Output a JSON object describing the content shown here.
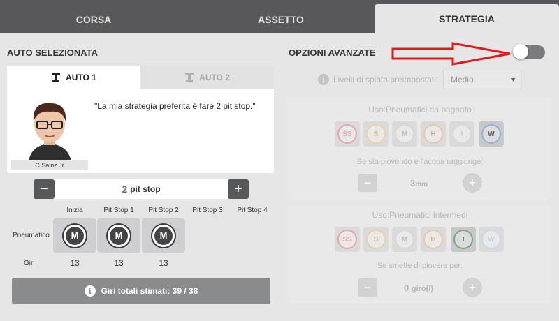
{
  "tabs": [
    {
      "label": "CORSA"
    },
    {
      "label": "ASSETTO"
    },
    {
      "label": "STRATEGIA"
    }
  ],
  "left": {
    "section_title": "AUTO SELEZIONATA",
    "car_tabs": [
      {
        "label": "AUTO 1"
      },
      {
        "label": "AUTO 2"
      }
    ],
    "driver_name": "C Sainz Jr",
    "quote": "\"La mia strategia preferita è fare 2 pit stop.\"",
    "pit_stepper": {
      "minus": "−",
      "value": "2",
      "unit": "pit stop",
      "plus": "+"
    },
    "columns": [
      "Inizia",
      "Pit Stop 1",
      "Pit Stop 2",
      "Pit Stop 3",
      "Pit Stop 4"
    ],
    "row_tyre_label": "Pneumatico",
    "row_laps_label": "Giri",
    "tyres": [
      "M",
      "M",
      "M"
    ],
    "laps": [
      "13",
      "13",
      "13"
    ],
    "total_laps": "Giri totali stimati: 39 / 38",
    "info_glyph": "i"
  },
  "right": {
    "section_title": "OPZIONI AVANZATE",
    "preset_label": "Livelli di spinta preimpostati:",
    "preset_value": "Medio",
    "preset_chevron": "▼",
    "wet_box": {
      "title": "Uso:Pneumatici da bagnato",
      "tyres": [
        "SS",
        "S",
        "M",
        "H",
        "I",
        "W"
      ],
      "subtitle": "Se sta piovendo e l'acqua raggiunge:",
      "value": "3",
      "unit": "mm"
    },
    "inter_box": {
      "title": "Uso:Pneumatici intermedi",
      "tyres": [
        "SS",
        "S",
        "M",
        "H",
        "I",
        "W"
      ],
      "subtitle": "Se smette di piovere per:",
      "value": "0",
      "unit": "giro(i)"
    },
    "minus": "−",
    "plus": "+"
  },
  "colors": {
    "tab_bar": "#58585a",
    "accent_green": "#4a8b3c",
    "arrow_red": "#e0191b",
    "tyre_ss": "#e9a6a6",
    "tyre_s": "#ecd2a1",
    "tyre_m": "#d8d8d8",
    "tyre_h": "#ecc8a7",
    "tyre_i": "#79a879",
    "tyre_w": "#8fb3db"
  }
}
